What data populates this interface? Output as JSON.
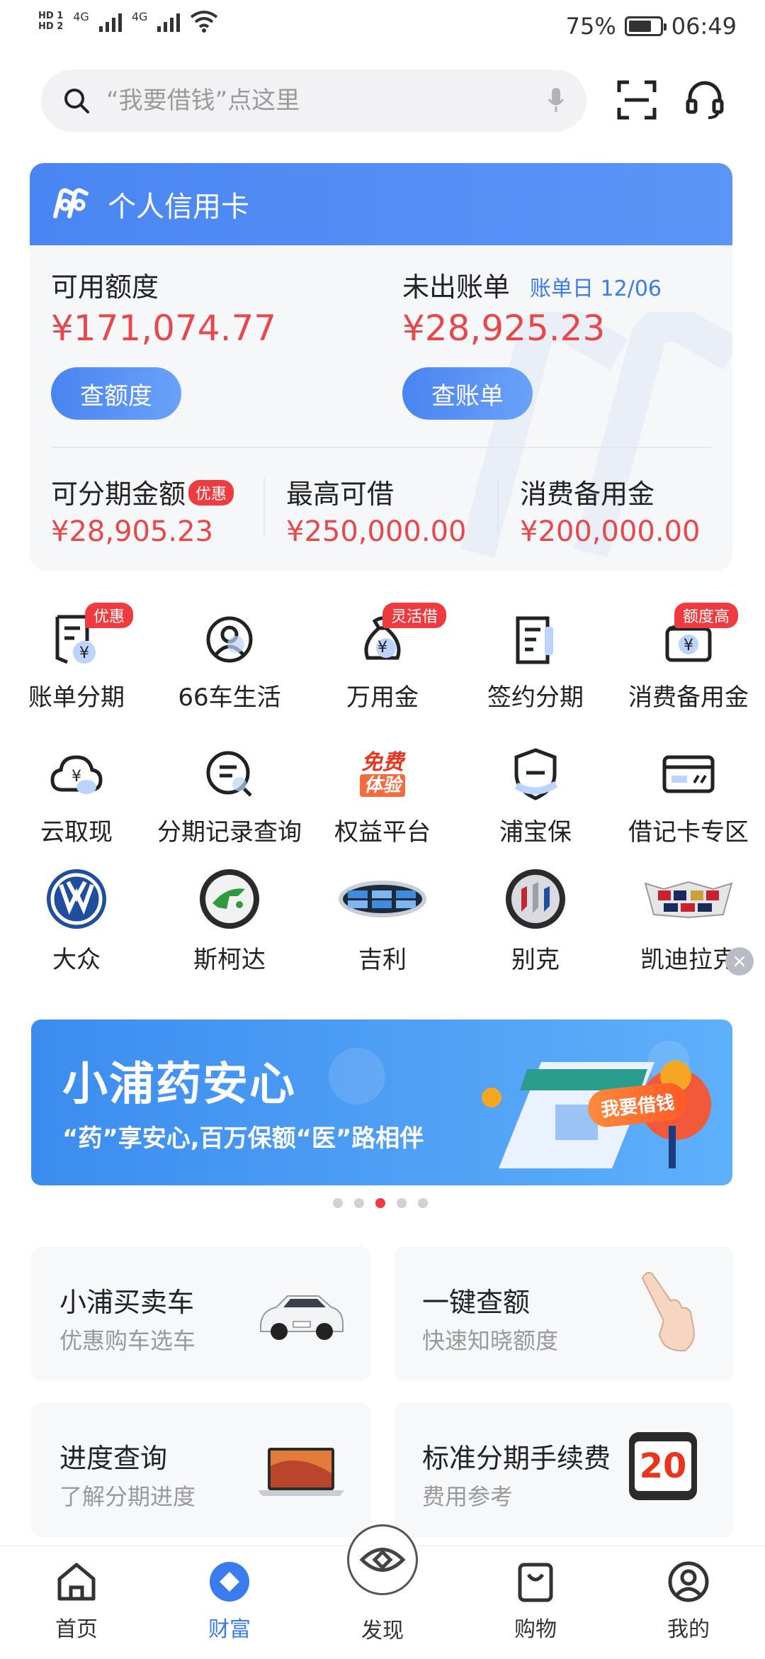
{
  "status_bar": {
    "hd1": "HD 1",
    "hd2": "HD 2",
    "net1": "4G",
    "net2": "4G",
    "battery": "75%",
    "battery_level": 0.75,
    "time": "06:49"
  },
  "search": {
    "placeholder": "“我要借钱”点这里"
  },
  "card": {
    "title": "个人信用卡",
    "available_label": "可用额度",
    "available_amount": "¥171,074.77",
    "available_button": "查额度",
    "unbilled_label": "未出账单",
    "bill_day": "账单日 12/06",
    "unbilled_amount": "¥28,925.23",
    "bill_button": "查账单",
    "installment_label": "可分期金额",
    "installment_badge": "优惠",
    "installment_amount": "¥28,905.23",
    "max_loan_label": "最高可借",
    "max_loan_amount": "¥250,000.00",
    "reserve_label": "消费备用金",
    "reserve_amount": "¥200,000.00"
  },
  "services_row1": [
    {
      "label": "账单分期",
      "tag": "优惠",
      "icon": "bill-installment-icon"
    },
    {
      "label": "66车生活",
      "tag": "",
      "icon": "car-life-icon"
    },
    {
      "label": "万用金",
      "tag": "灵活借",
      "icon": "money-bag-icon"
    },
    {
      "label": "签约分期",
      "tag": "",
      "icon": "contract-icon"
    },
    {
      "label": "消费备用金",
      "tag": "额度高",
      "icon": "wallet-icon"
    }
  ],
  "services_row2": [
    {
      "label": "云取现",
      "icon": "cloud-cash-icon"
    },
    {
      "label": "分期记录查询",
      "icon": "record-search-icon"
    },
    {
      "label": "权益平台",
      "icon": "free-trial-icon",
      "art_line1": "免费",
      "art_line2": "体验"
    },
    {
      "label": "浦宝保",
      "icon": "shield-icon"
    },
    {
      "label": "借记卡专区",
      "icon": "debit-card-icon"
    }
  ],
  "brands": [
    {
      "label": "大众",
      "icon": "volkswagen-logo"
    },
    {
      "label": "斯柯达",
      "icon": "skoda-logo"
    },
    {
      "label": "吉利",
      "icon": "geely-logo"
    },
    {
      "label": "别克",
      "icon": "buick-logo"
    },
    {
      "label": "凯迪拉克",
      "icon": "cadillac-logo"
    }
  ],
  "banner": {
    "title": "小浦药安心",
    "subtitle": "“药”享安心,百万保额“医”路相伴",
    "cta": "我要借钱",
    "pages": 5,
    "active_page": 3
  },
  "tiles": [
    {
      "title": "小浦买卖车",
      "subtitle": "优惠购车选车",
      "icon": "car-image"
    },
    {
      "title": "一键查额",
      "subtitle": "快速知晓额度",
      "icon": "finger-tap-image"
    },
    {
      "title": "进度查询",
      "subtitle": "了解分期进度",
      "icon": "laptop-image"
    },
    {
      "title": "标准分期手续费",
      "subtitle": "费用参考",
      "icon": "calendar-image",
      "calendar_number": "20"
    }
  ],
  "nav": [
    {
      "label": "首页",
      "icon": "home-icon"
    },
    {
      "label": "财富",
      "icon": "wealth-icon"
    },
    {
      "label": "发现",
      "icon": "discover-eye-icon"
    },
    {
      "label": "购物",
      "icon": "shopping-bag-icon"
    },
    {
      "label": "我的",
      "icon": "profile-icon"
    }
  ],
  "colors": {
    "primary_blue": "#4a86f2",
    "accent_red": "#e8474b",
    "badge_red": "#ee3b3f"
  }
}
